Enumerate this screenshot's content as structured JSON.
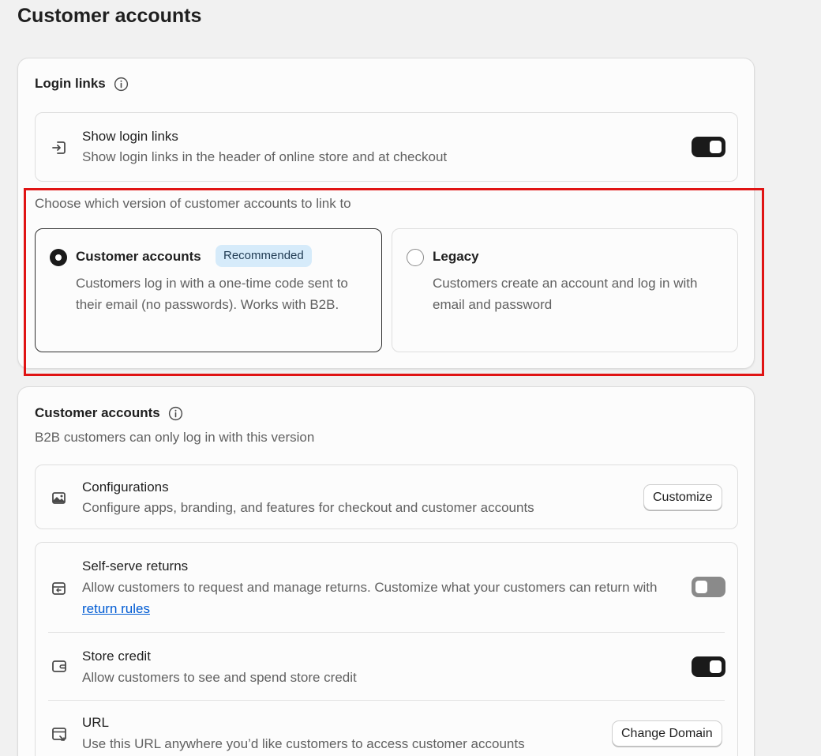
{
  "page": {
    "title": "Customer accounts"
  },
  "login_links": {
    "header": "Login links",
    "show_login": {
      "title": "Show login links",
      "description": "Show login links in the header of online store and at checkout",
      "enabled": true
    },
    "choose_label": "Choose which version of customer accounts to link to",
    "options": [
      {
        "title": "Customer accounts",
        "badge": "Recommended",
        "description": "Customers log in with a one-time code sent to their email (no passwords). Works with B2B.",
        "selected": true
      },
      {
        "title": "Legacy",
        "description": "Customers create an account and log in with email and password",
        "selected": false
      }
    ]
  },
  "customer_accounts": {
    "header": "Customer accounts",
    "subtitle": "B2B customers can only log in with this version",
    "configurations": {
      "title": "Configurations",
      "description": "Configure apps, branding, and features for checkout and customer accounts",
      "button": "Customize"
    },
    "self_serve_returns": {
      "title": "Self-serve returns",
      "description_prefix": "Allow customers to request and manage returns. Customize what your customers can return with",
      "link": "return rules",
      "enabled": false
    },
    "store_credit": {
      "title": "Store credit",
      "description": "Allow customers to see and spend store credit",
      "enabled": true
    },
    "url": {
      "title": "URL",
      "description": "Use this URL anywhere you’d like customers to access customer accounts",
      "button": "Change Domain"
    }
  },
  "colors": {
    "accent_dark": "#1a1a1a",
    "badge_bg": "#d6ebfa",
    "highlight": "#e01414",
    "link": "#005bd3"
  }
}
